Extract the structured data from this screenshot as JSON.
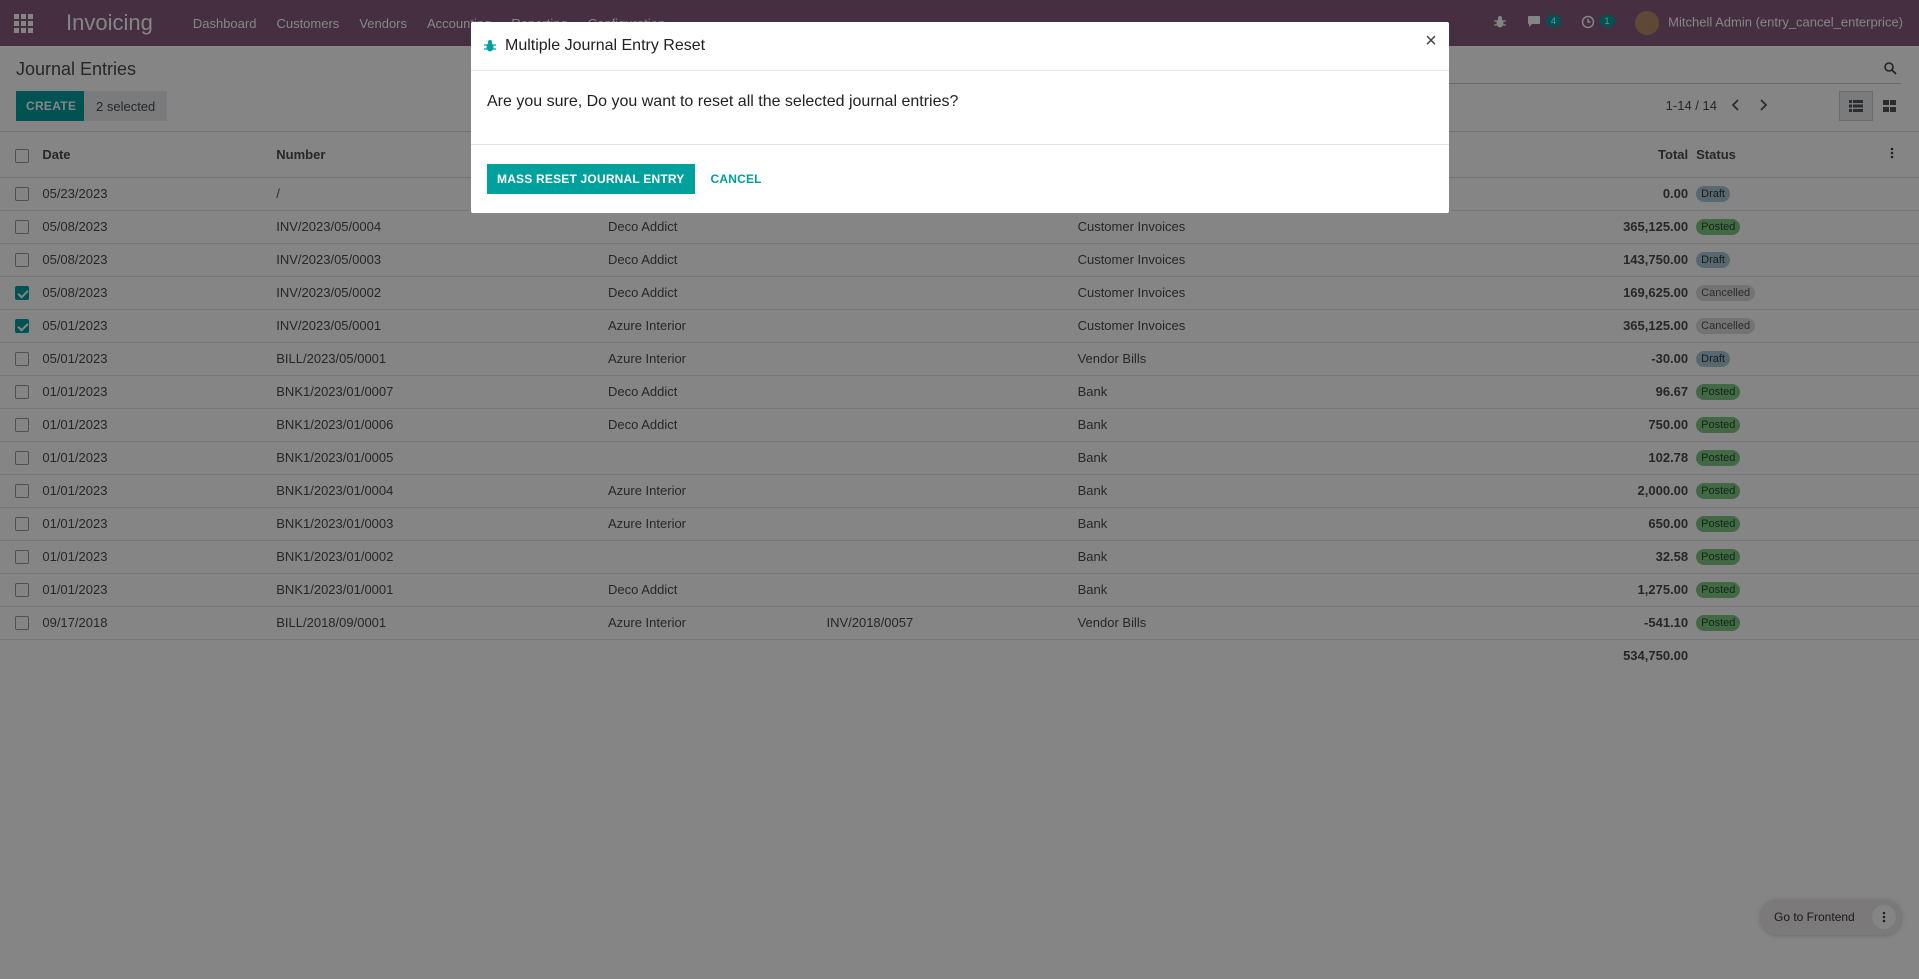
{
  "navbar": {
    "app_title": "Invoicing",
    "menu": [
      "Dashboard",
      "Customers",
      "Vendors",
      "Accounting",
      "Reporting",
      "Configuration"
    ],
    "messages_count": "4",
    "activities_count": "1",
    "user": "Mitchell Admin (entry_cancel_enterprice)"
  },
  "control_panel": {
    "title": "Journal Entries",
    "create_label": "CREATE",
    "selected_label": "2 selected",
    "pager": "1-14 / 14"
  },
  "table": {
    "headers": {
      "date": "Date",
      "number": "Number",
      "partner": "",
      "reference": "",
      "journal": "",
      "total": "Total",
      "status": "Status"
    },
    "rows": [
      {
        "checked": false,
        "date": "05/23/2023",
        "number": "/",
        "partner": "",
        "reference": "",
        "journal": "",
        "total": "0.00",
        "status": "Draft",
        "status_kind": "draft"
      },
      {
        "checked": false,
        "date": "05/08/2023",
        "number": "INV/2023/05/0004",
        "partner": "Deco Addict",
        "reference": "",
        "journal": "Customer Invoices",
        "total": "365,125.00",
        "status": "Posted",
        "status_kind": "posted"
      },
      {
        "checked": false,
        "date": "05/08/2023",
        "number": "INV/2023/05/0003",
        "partner": "Deco Addict",
        "reference": "",
        "journal": "Customer Invoices",
        "total": "143,750.00",
        "status": "Draft",
        "status_kind": "draft"
      },
      {
        "checked": true,
        "date": "05/08/2023",
        "number": "INV/2023/05/0002",
        "partner": "Deco Addict",
        "reference": "",
        "journal": "Customer Invoices",
        "total": "169,625.00",
        "status": "Cancelled",
        "status_kind": "cancelled"
      },
      {
        "checked": true,
        "date": "05/01/2023",
        "number": "INV/2023/05/0001",
        "partner": "Azure Interior",
        "reference": "",
        "journal": "Customer Invoices",
        "total": "365,125.00",
        "status": "Cancelled",
        "status_kind": "cancelled"
      },
      {
        "checked": false,
        "date": "05/01/2023",
        "number": "BILL/2023/05/0001",
        "partner": "Azure Interior",
        "reference": "",
        "journal": "Vendor Bills",
        "total": "-30.00",
        "status": "Draft",
        "status_kind": "draft"
      },
      {
        "checked": false,
        "date": "01/01/2023",
        "number": "BNK1/2023/01/0007",
        "partner": "Deco Addict",
        "reference": "",
        "journal": "Bank",
        "total": "96.67",
        "status": "Posted",
        "status_kind": "posted"
      },
      {
        "checked": false,
        "date": "01/01/2023",
        "number": "BNK1/2023/01/0006",
        "partner": "Deco Addict",
        "reference": "",
        "journal": "Bank",
        "total": "750.00",
        "status": "Posted",
        "status_kind": "posted"
      },
      {
        "checked": false,
        "date": "01/01/2023",
        "number": "BNK1/2023/01/0005",
        "partner": "",
        "reference": "",
        "journal": "Bank",
        "total": "102.78",
        "status": "Posted",
        "status_kind": "posted"
      },
      {
        "checked": false,
        "date": "01/01/2023",
        "number": "BNK1/2023/01/0004",
        "partner": "Azure Interior",
        "reference": "",
        "journal": "Bank",
        "total": "2,000.00",
        "status": "Posted",
        "status_kind": "posted"
      },
      {
        "checked": false,
        "date": "01/01/2023",
        "number": "BNK1/2023/01/0003",
        "partner": "Azure Interior",
        "reference": "",
        "journal": "Bank",
        "total": "650.00",
        "status": "Posted",
        "status_kind": "posted"
      },
      {
        "checked": false,
        "date": "01/01/2023",
        "number": "BNK1/2023/01/0002",
        "partner": "",
        "reference": "",
        "journal": "Bank",
        "total": "32.58",
        "status": "Posted",
        "status_kind": "posted"
      },
      {
        "checked": false,
        "date": "01/01/2023",
        "number": "BNK1/2023/01/0001",
        "partner": "Deco Addict",
        "reference": "",
        "journal": "Bank",
        "total": "1,275.00",
        "status": "Posted",
        "status_kind": "posted"
      },
      {
        "checked": false,
        "date": "09/17/2018",
        "number": "BILL/2018/09/0001",
        "partner": "Azure Interior",
        "reference": "INV/2018/0057",
        "journal": "Vendor Bills",
        "total": "-541.10",
        "status": "Posted",
        "status_kind": "posted"
      }
    ],
    "footer_total": "534,750.00"
  },
  "dialog": {
    "title": "Multiple Journal Entry Reset",
    "close_label": "×",
    "message": "Are you sure, Do you want to reset all the selected journal entries?",
    "primary_label": "MASS RESET JOURNAL ENTRY",
    "cancel_label": "CANCEL"
  },
  "frontend": {
    "label": "Go to Frontend"
  },
  "colors": {
    "navbar": "#875a7b",
    "primary": "#00a09d"
  }
}
